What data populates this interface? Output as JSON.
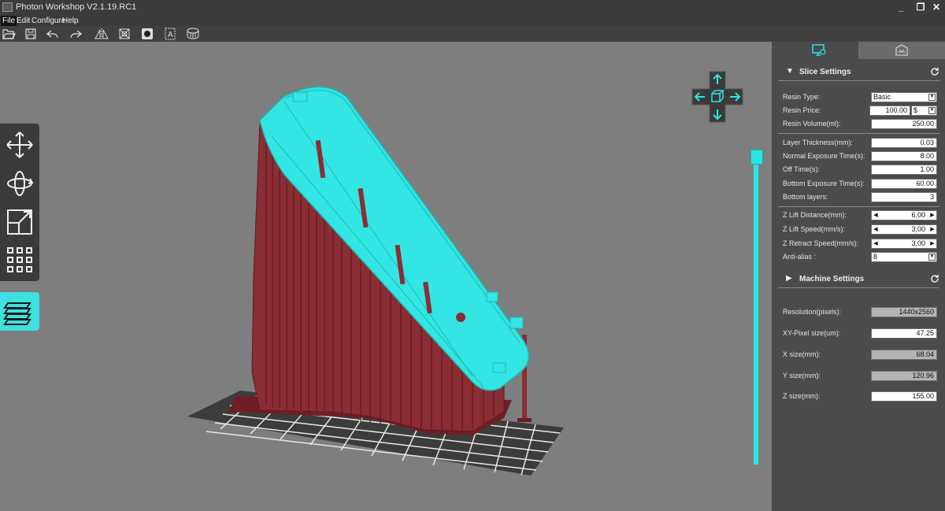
{
  "window": {
    "title": "Photon Workshop V2.1.19.RC1",
    "controls": [
      "_",
      "❐",
      "✕"
    ]
  },
  "menu": [
    "File",
    "Edit",
    "Configure",
    "Help"
  ],
  "toolbar": [
    "open-file-icon",
    "save-icon",
    "undo-icon",
    "redo-icon",
    "mirror-icon",
    "hollow-icon",
    "punch-icon",
    "text-icon",
    "base-icon"
  ],
  "left_tools": [
    "move-icon",
    "rotate-icon",
    "scale-icon",
    "arrange-icon",
    "layers-icon"
  ],
  "colors": {
    "accent": "#2ee5e5",
    "supports": "#8b2d34",
    "panel": "#4b4b4b",
    "background": "#7e7e7e"
  },
  "slice_settings": {
    "title": "Slice Settings",
    "resin_type": {
      "label": "Resin Type:",
      "value": "Basic"
    },
    "resin_price": {
      "label": "Resin Price:",
      "value": "100.00",
      "currency": "$"
    },
    "resin_volume": {
      "label": "Resin Volume(ml):",
      "value": "250.00"
    },
    "layer_thickness": {
      "label": "Layer Thickness(mm):",
      "value": "0.03"
    },
    "normal_exposure": {
      "label": "Normal Exposure Time(s):",
      "value": "8.00"
    },
    "off_time": {
      "label": "Off Time(s):",
      "value": "1.00"
    },
    "bottom_exposure": {
      "label": "Bottom Exposure Time(s):",
      "value": "60.00"
    },
    "bottom_layers": {
      "label": "Bottom layers:",
      "value": "3"
    },
    "z_lift_distance": {
      "label": "Z Lift Distance(mm):",
      "value": "6,00"
    },
    "z_lift_speed": {
      "label": "Z Lift Speed(mm/s):",
      "value": "3,00"
    },
    "z_retract_speed": {
      "label": "Z Retract Speed(mm/s):",
      "value": "3,00"
    },
    "anti_alias": {
      "label": "Anti-alias :",
      "value": "8"
    }
  },
  "machine_settings": {
    "title": "Machine Settings",
    "resolution": {
      "label": "Resolution(pixels):",
      "value": "1440x2560"
    },
    "xy_pixel": {
      "label": "XY-Pixel size(um):",
      "value": "47.25"
    },
    "x_size": {
      "label": "X size(mm):",
      "value": "68.04"
    },
    "y_size": {
      "label": "Y size(mm):",
      "value": "120.96"
    },
    "z_size": {
      "label": "Z size(mm):",
      "value": "155.00"
    }
  },
  "layer_slider": {
    "position": 1.0
  }
}
